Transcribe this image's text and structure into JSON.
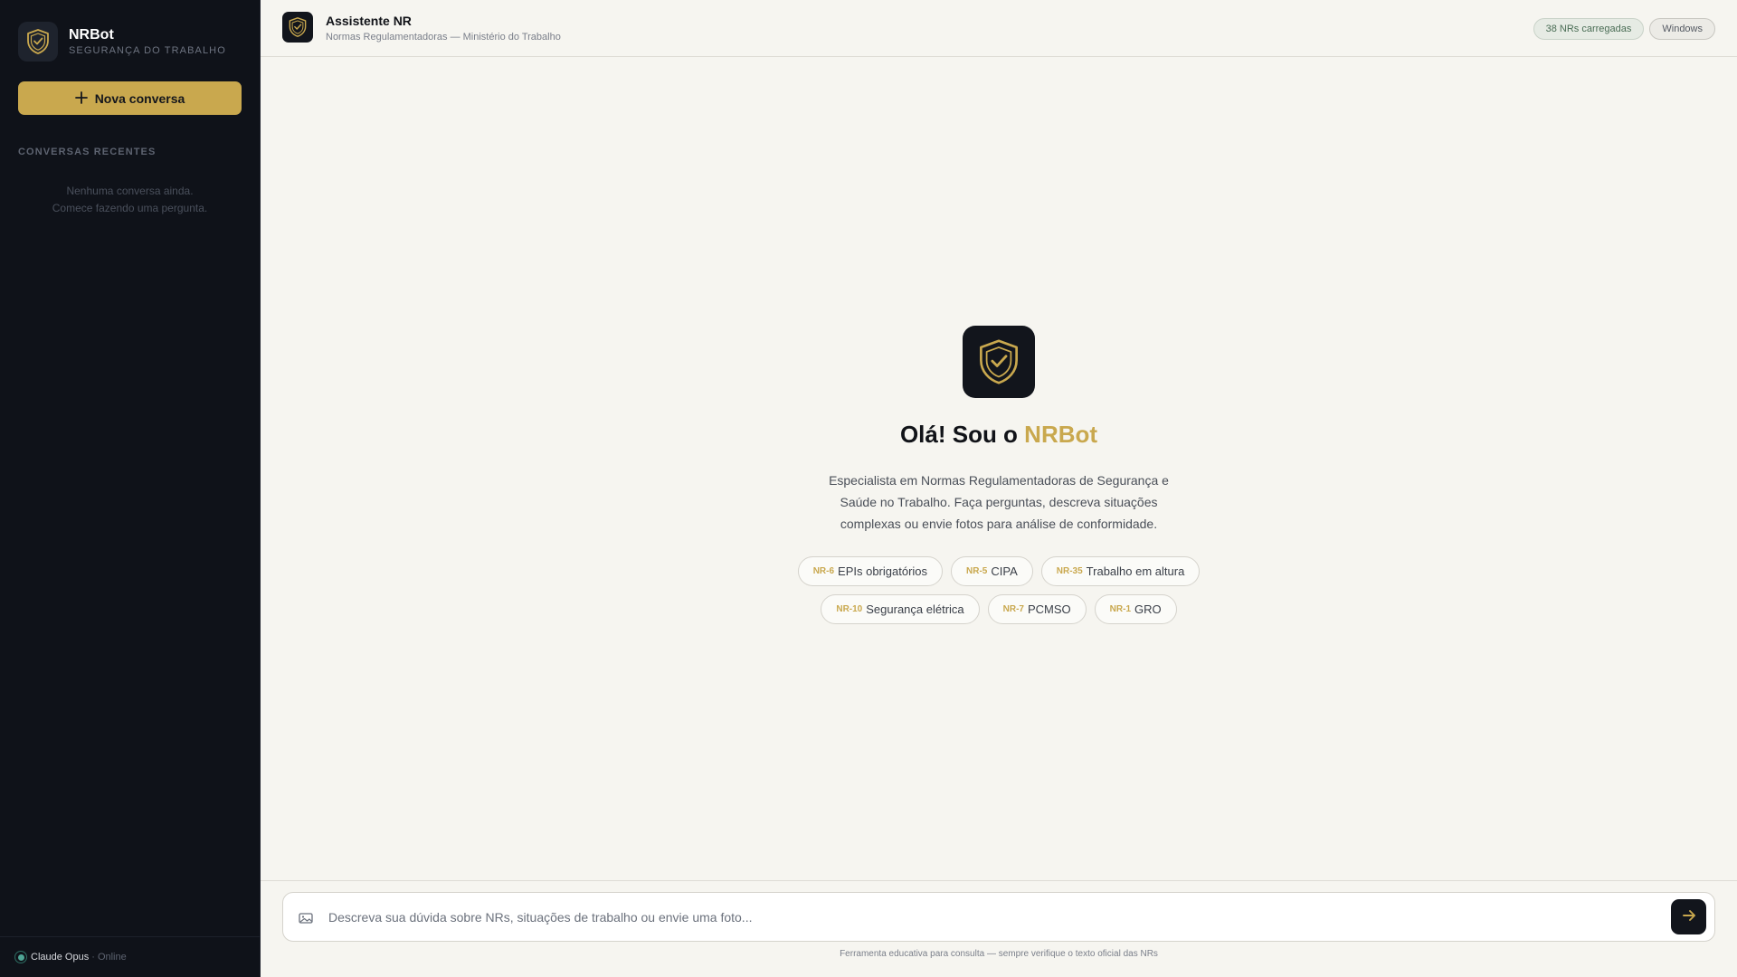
{
  "sidebar": {
    "brand_name": "NRBot",
    "brand_subtitle": "SEGURANÇA DO TRABALHO",
    "new_chat_label": "Nova conversa",
    "recent_title": "CONVERSAS RECENTES",
    "empty_line1": "Nenhuma conversa ainda.",
    "empty_line2": "Comece fazendo uma pergunta.",
    "model_name": "Claude Opus",
    "model_status": "· Online"
  },
  "header": {
    "title": "Assistente NR",
    "subtitle": "Normas Regulamentadoras — Ministério do Trabalho",
    "badge_loaded": "38 NRs carregadas",
    "badge_os": "Windows"
  },
  "welcome": {
    "title_prefix": "Olá! Sou o",
    "title_accent": "NRBot",
    "description": "Especialista em Normas Regulamentadoras de Segurança e Saúde no Trabalho. Faça perguntas, descreva situações complexas ou envie fotos para análise de conformidade.",
    "chips": [
      {
        "code": "NR-6",
        "label": "EPIs obrigatórios"
      },
      {
        "code": "NR-5",
        "label": "CIPA"
      },
      {
        "code": "NR-35",
        "label": "Trabalho em altura"
      },
      {
        "code": "NR-10",
        "label": "Segurança elétrica"
      },
      {
        "code": "NR-7",
        "label": "PCMSO"
      },
      {
        "code": "NR-1",
        "label": "GRO"
      }
    ]
  },
  "composer": {
    "placeholder": "Descreva sua dúvida sobre NRs, situações de trabalho ou envie uma foto...",
    "value": "",
    "disclaimer": "Ferramenta educativa para consulta — sempre verifique o texto oficial das NRs"
  },
  "colors": {
    "accent": "#c9a84e",
    "sidebar_bg": "#0f1219",
    "page_bg": "#f6f5f0",
    "online": "#4fa595"
  },
  "icons": {
    "logo": "shield-check-icon",
    "new_chat": "plus-icon",
    "attach": "image-icon",
    "send": "arrow-right-icon",
    "status": "online-dot-icon"
  }
}
